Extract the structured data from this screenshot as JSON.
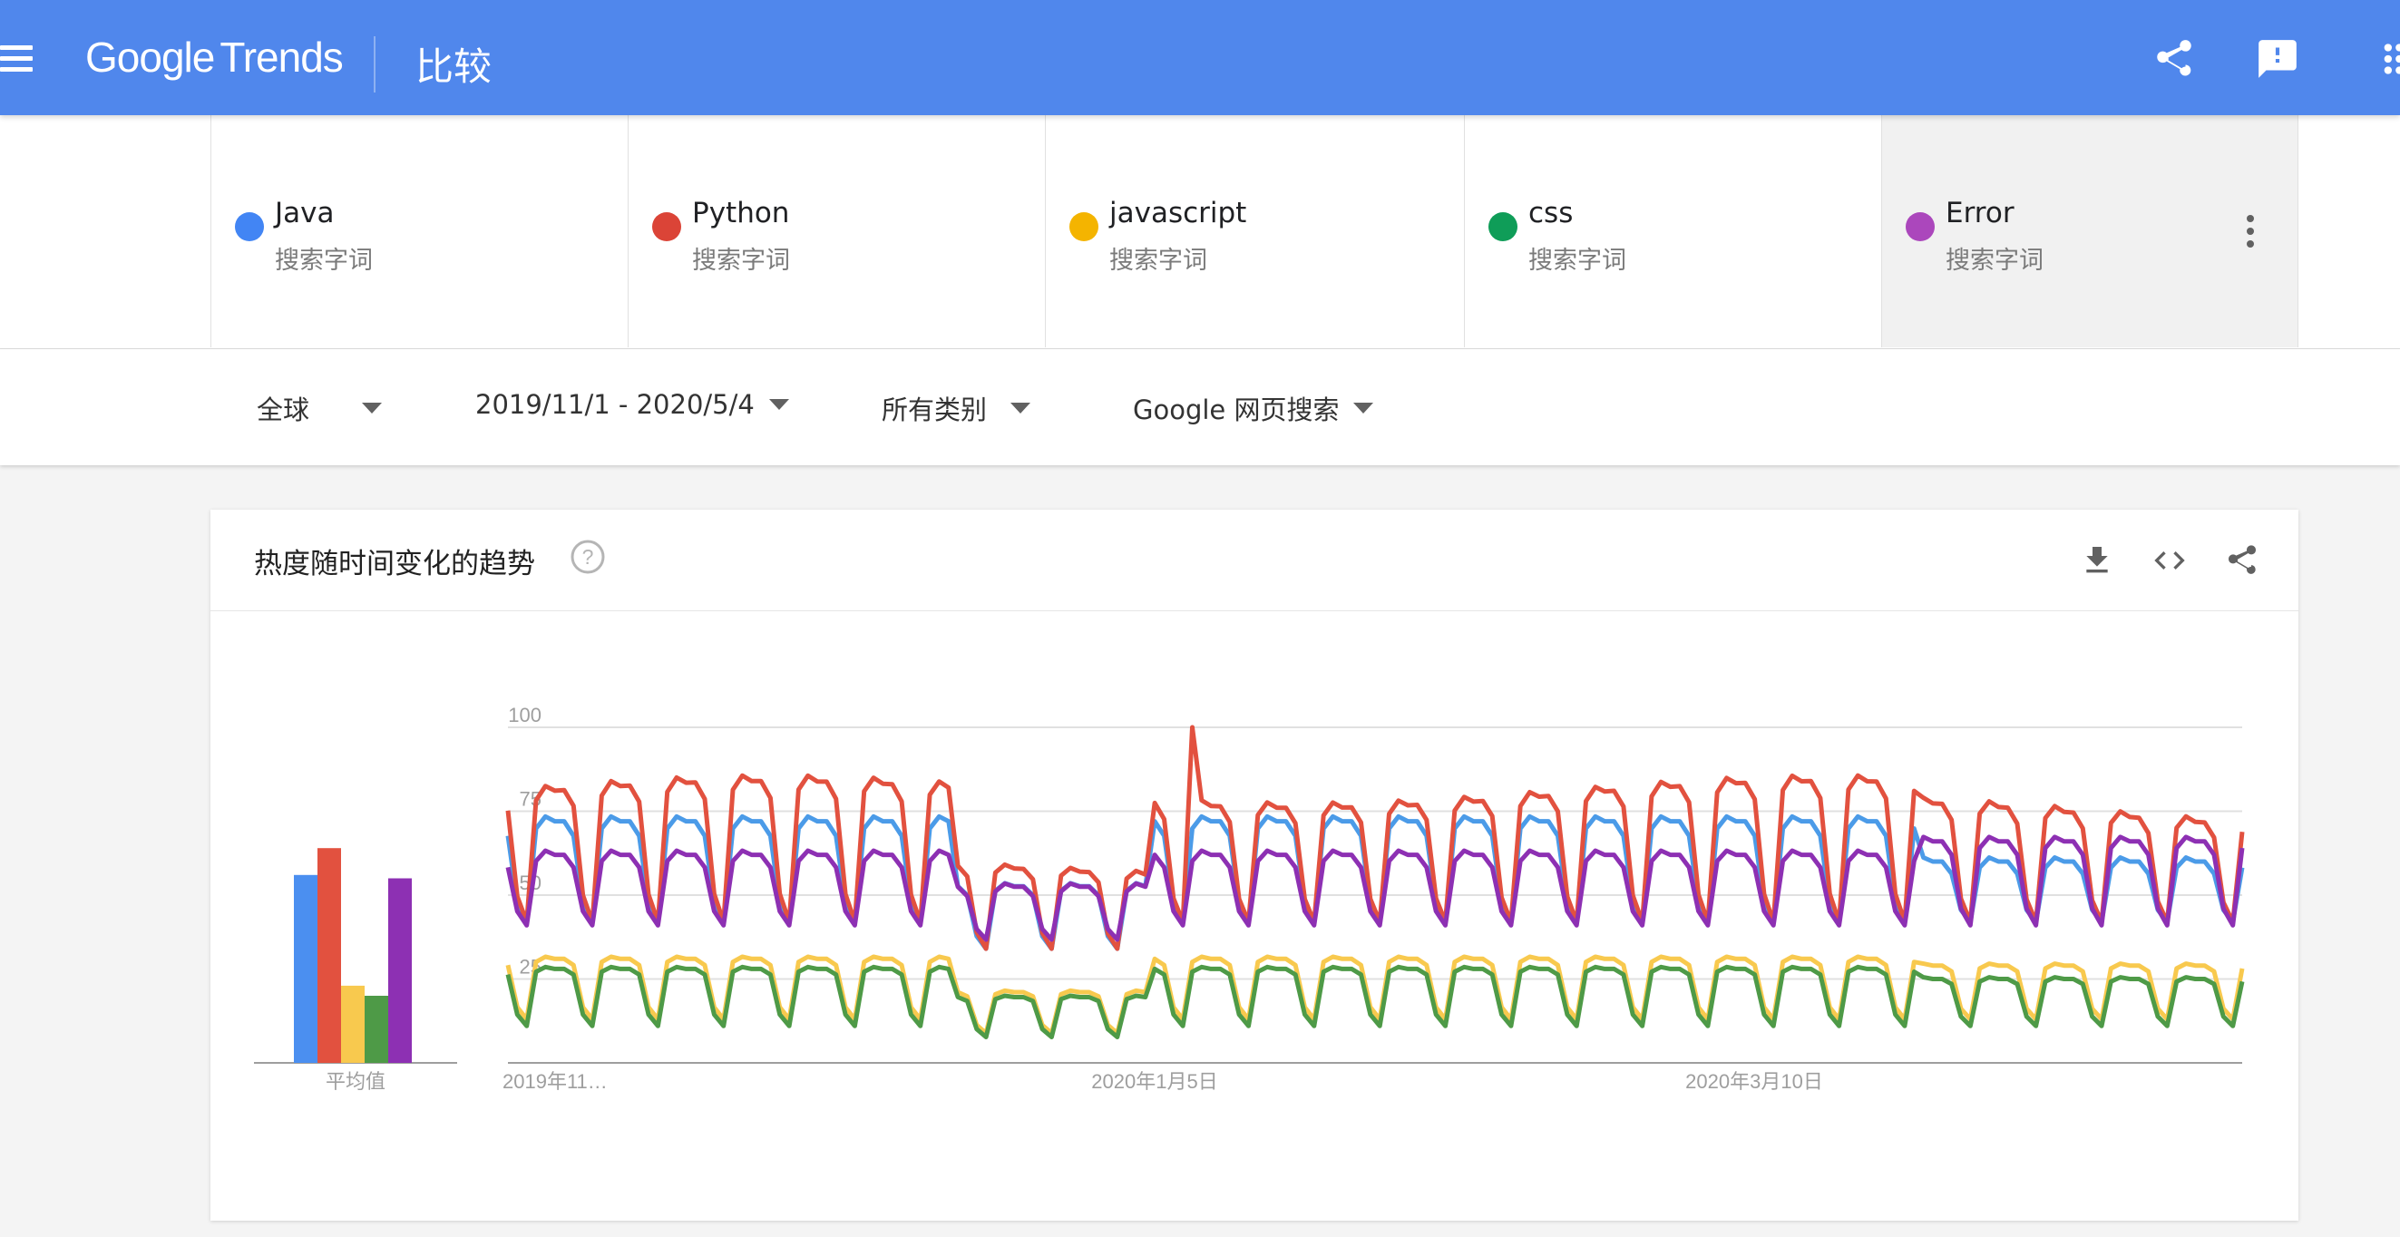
{
  "header": {
    "logo_google": "Google",
    "logo_trends": "Trends",
    "page_title": "比较"
  },
  "terms": [
    {
      "name": "Java",
      "sub": "搜索字词",
      "color": "#4285f4"
    },
    {
      "name": "Python",
      "sub": "搜索字词",
      "color": "#db4437"
    },
    {
      "name": "javascript",
      "sub": "搜索字词",
      "color": "#f4b400"
    },
    {
      "name": "css",
      "sub": "搜索字词",
      "color": "#0f9d58"
    },
    {
      "name": "Error",
      "sub": "搜索字词",
      "color": "#ab47bc"
    }
  ],
  "filters": {
    "region": "全球",
    "date_range": "2019/11/1 - 2020/5/4",
    "category": "所有类别",
    "search_type": "Google 网页搜索"
  },
  "card": {
    "title": "热度随时间变化的趋势"
  },
  "chart_data": {
    "type": "line",
    "x_labels": [
      "2019年11…",
      "2020年1月5日",
      "2020年3月10日"
    ],
    "y_ticks": [
      25,
      50,
      75,
      100
    ],
    "ylim": [
      0,
      100
    ],
    "grid": true,
    "average_label": "平均值",
    "averages": [
      {
        "name": "Java",
        "value": 56,
        "color": "#4b8ff0"
      },
      {
        "name": "Python",
        "value": 64,
        "color": "#e2513f"
      },
      {
        "name": "javascript",
        "value": 23,
        "color": "#f8c94e"
      },
      {
        "name": "css",
        "value": 20,
        "color": "#4e9a47"
      },
      {
        "name": "Error",
        "value": 55,
        "color": "#8d30b3"
      }
    ],
    "series": [
      {
        "name": "Java",
        "color": "#4b9be8"
      },
      {
        "name": "Python",
        "color": "#e2513f"
      },
      {
        "name": "javascript",
        "color": "#f8c94e"
      },
      {
        "name": "css",
        "color": "#4e9a47"
      },
      {
        "name": "Error",
        "color": "#8d30b3"
      }
    ]
  }
}
